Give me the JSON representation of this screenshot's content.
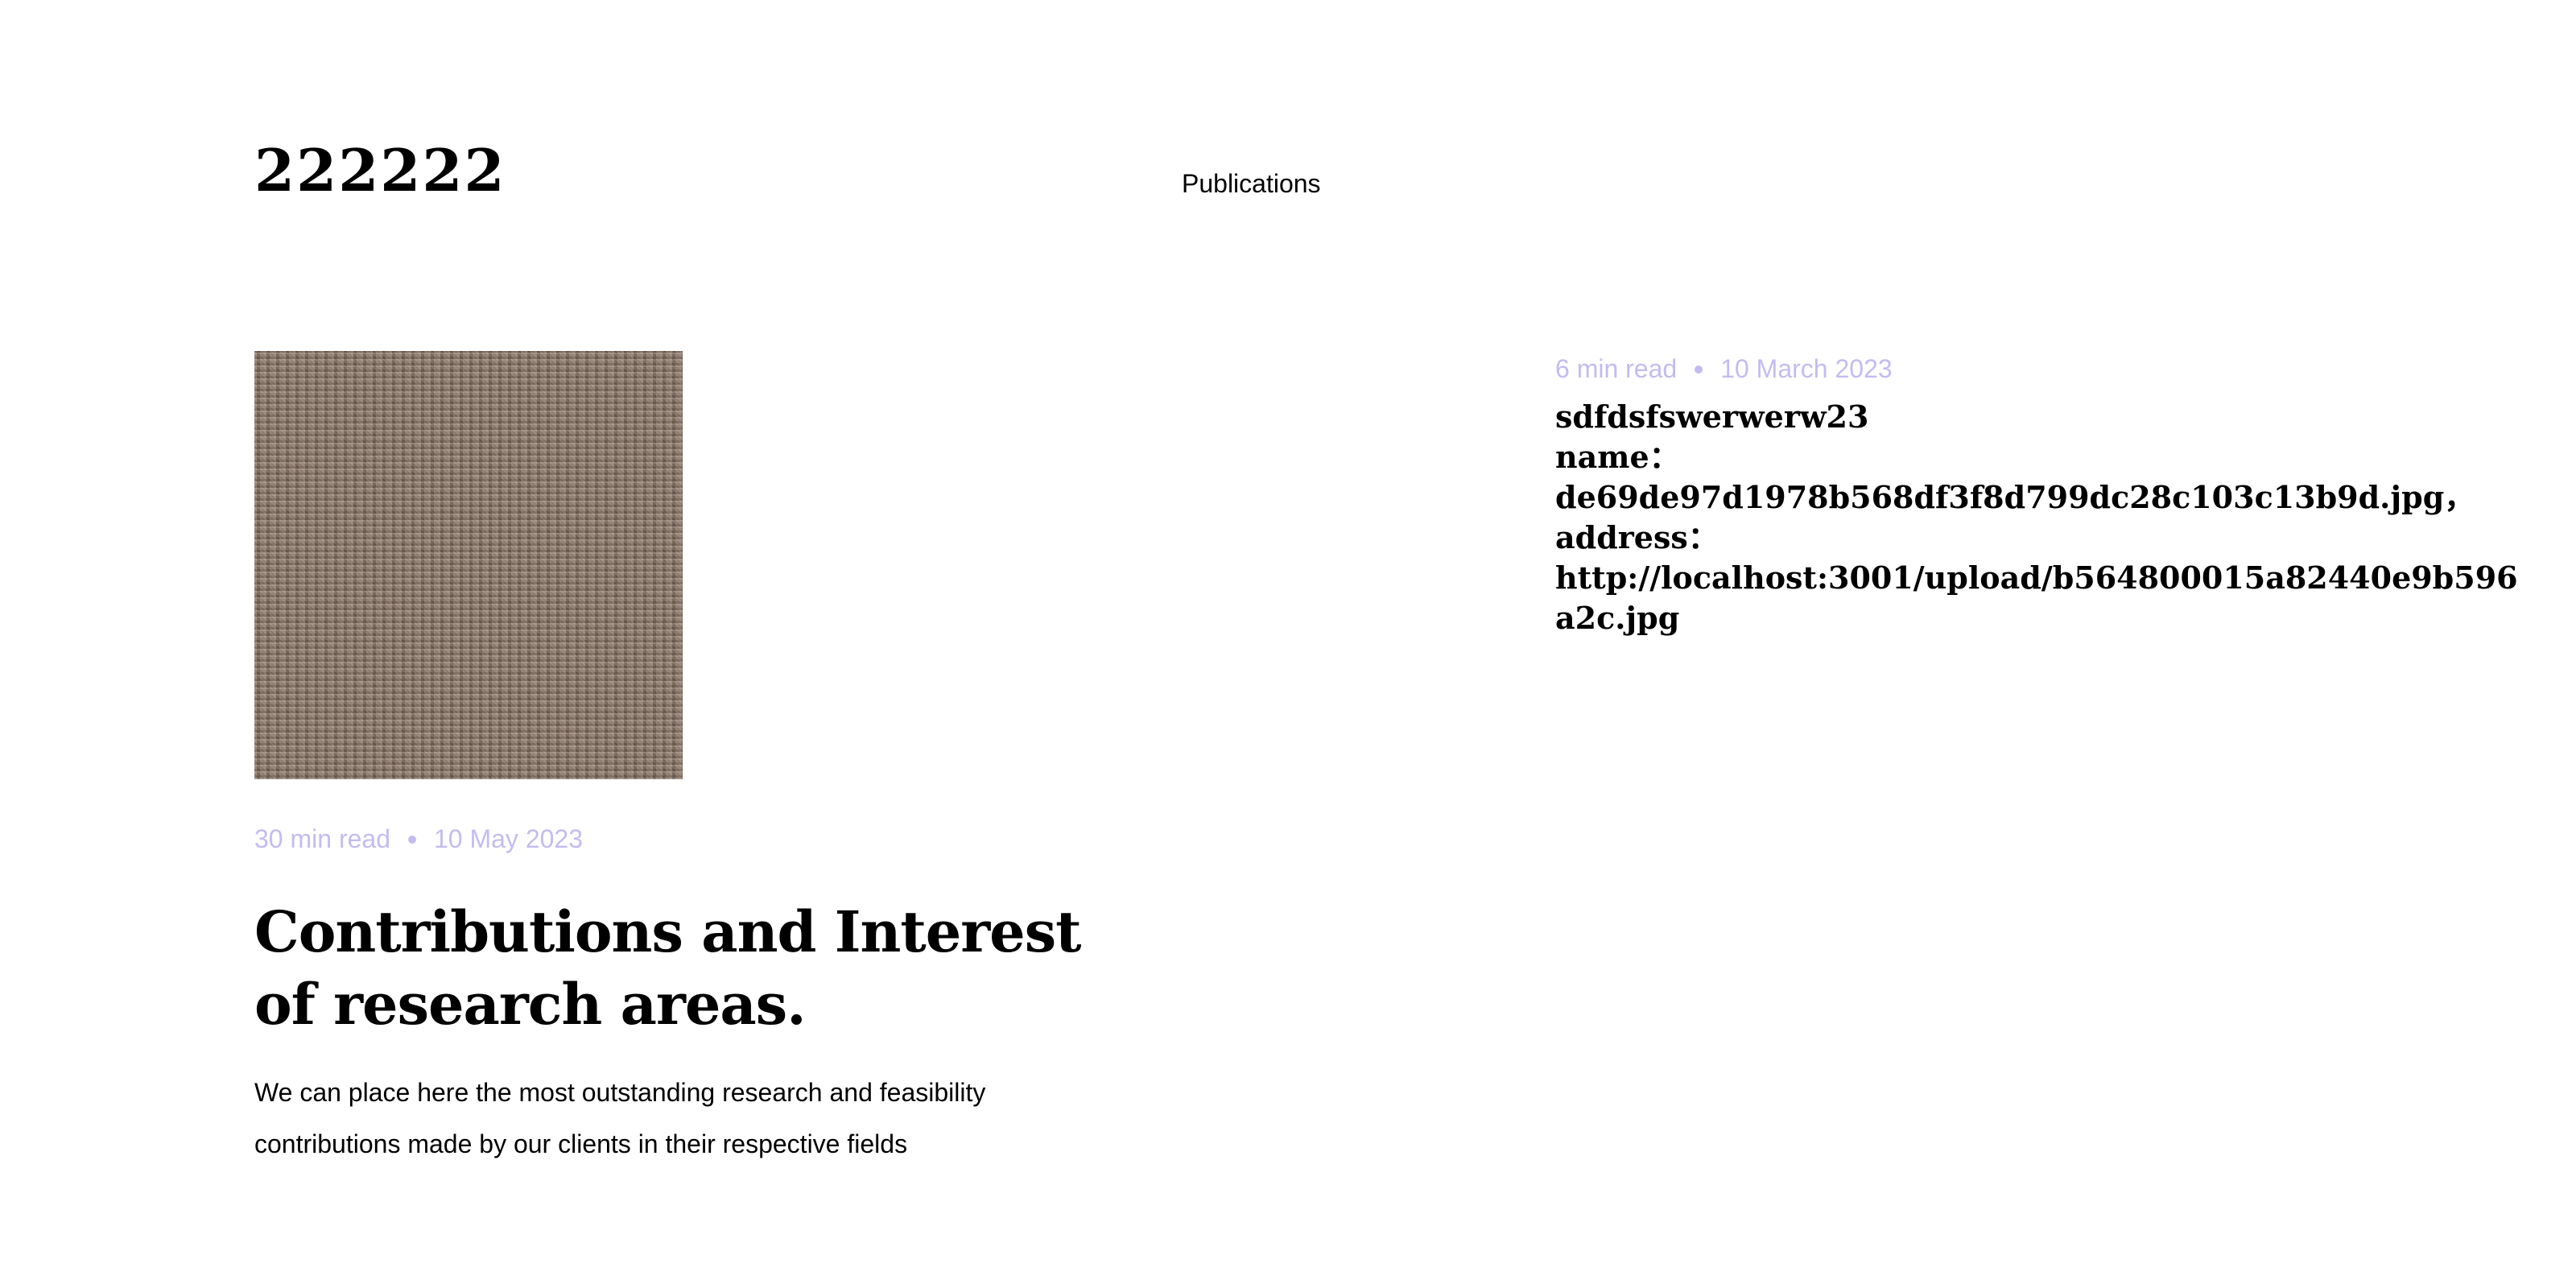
{
  "header": {
    "brand": "222222",
    "nav_publications": "Publications"
  },
  "posts": [
    {
      "read_time": "30 min read",
      "date": "10 May 2023",
      "title": "Contributions and Interest of research areas.",
      "description": "We can place here the most outstanding research and feasibility contributions made by our clients in their respective fields"
    },
    {
      "read_time": "6 min read",
      "date": "10 March 2023",
      "title": "sdfdsfswerwerw23\nname：\nde69de97d1978b568df3f8d799dc28c103c13b9d.jpg，\naddress：\nhttp://localhost:3001/upload/b564800015a82440e9b596a2c.jpg"
    }
  ],
  "colors": {
    "meta_text": "#c5bbf0",
    "text": "#000000",
    "background": "#ffffff"
  }
}
